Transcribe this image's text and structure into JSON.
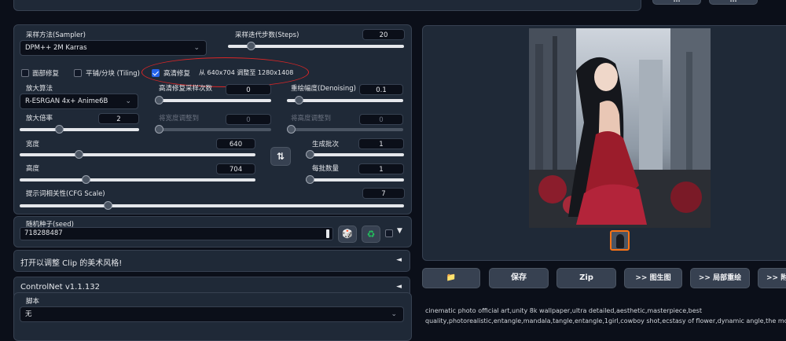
{
  "top": {
    "btn1": "...",
    "btn2": "..."
  },
  "sampler": {
    "label": "采样方法(Sampler)",
    "value": "DPM++ 2M Karras"
  },
  "steps": {
    "label": "采样迭代步数(Steps)",
    "value": "20",
    "fraction": 0.13
  },
  "checks": {
    "face": {
      "label": "面部修复",
      "checked": false
    },
    "tiling": {
      "label": "平铺/分块 (Tiling)",
      "checked": false
    },
    "hires": {
      "label": "高清修复",
      "checked": true,
      "note": "从 640x704 调整至 1280x1408"
    }
  },
  "upscaler": {
    "label": "放大算法",
    "value": "R-ESRGAN 4x+ Anime6B"
  },
  "hires_steps": {
    "label": "高清修复采样次数",
    "value": "0",
    "fraction": 0.0
  },
  "denoise": {
    "label": "重绘幅度(Denoising)",
    "value": "0.1",
    "fraction": 0.1
  },
  "scale": {
    "label": "放大倍率",
    "value": "2",
    "fraction": 0.33
  },
  "resize_w": {
    "label": "将宽度调整到",
    "value": "0",
    "fraction": 0.0
  },
  "resize_h": {
    "label": "将高度调整到",
    "value": "0",
    "fraction": 0.0
  },
  "width": {
    "label": "宽度",
    "value": "640",
    "fraction": 0.25
  },
  "batch_count": {
    "label": "生成批次",
    "value": "1",
    "fraction": 0.0
  },
  "height": {
    "label": "高度",
    "value": "704",
    "fraction": 0.28
  },
  "batch_size": {
    "label": "每批数量",
    "value": "1",
    "fraction": 0.0
  },
  "cfg": {
    "label": "提示词相关性(CFG Scale)",
    "value": "7",
    "fraction": 0.23
  },
  "swap_icon": "⇅",
  "seed": {
    "label": "随机种子(seed)",
    "value": "718288487",
    "dice_icon": "🎲",
    "recycle_icon": "♻"
  },
  "accordions": [
    {
      "label": "打开以调整 Clip 的美术风格!",
      "arrow": "◄"
    },
    {
      "label": "ControlNet v1.1.132",
      "arrow": "◄"
    }
  ],
  "script": {
    "label": "脚本",
    "value": "无"
  },
  "actions": {
    "folder_icon": "📁",
    "save": "保存",
    "zip": "Zip",
    "to_img2img": ">> 图生图",
    "to_inpaint": ">> 局部重绘",
    "to_extras": ">> 附加"
  },
  "prompt_line1": "cinematic photo official art,unity 8k wallpaper,ultra detailed,aesthetic,masterpiece,best",
  "prompt_line2": "quality,photorealistic,entangle,mandala,tangle,entangle,1girl,cowboy shot,ecstasy of flower,dynamic angle,the most beau",
  "colors": {
    "bg": "#0b0f19",
    "panel": "#1f2937",
    "border": "#374151",
    "accent": "#2563eb",
    "annotation": "#dc2626"
  }
}
